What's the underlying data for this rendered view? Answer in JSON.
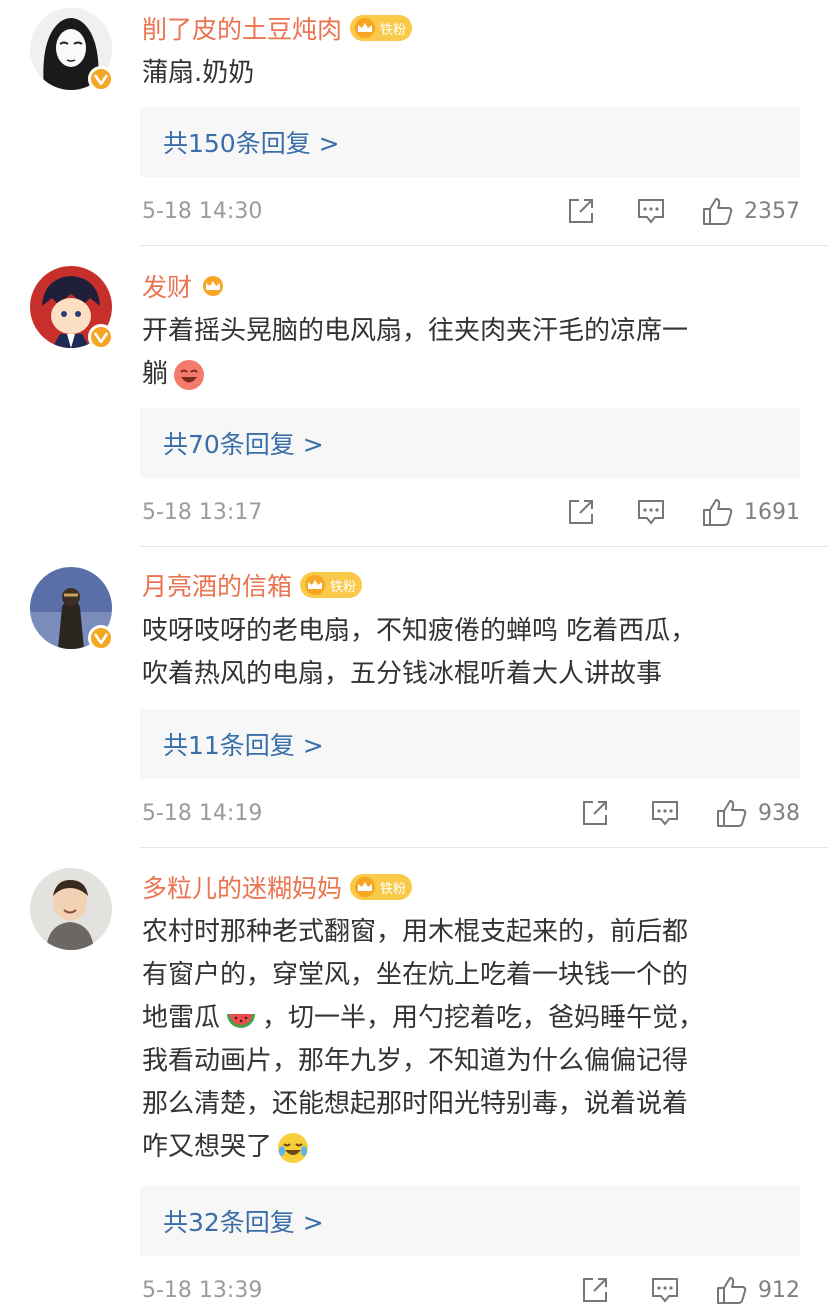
{
  "comments": [
    {
      "username": "削了皮的土豆炖肉",
      "fan_badge_text": "铁粉",
      "text": [
        "蒲扇.奶奶"
      ],
      "replies_label": "共150条回复 >",
      "time": "5-18 14:30",
      "likes": "2357"
    },
    {
      "username": "发财",
      "fan_badge_text": "",
      "text": [
        "开着摇头晃脑的电风扇，往夹肉夹汗毛的凉席一",
        "躺"
      ],
      "replies_label": "共70条回复 >",
      "time": "5-18 13:17",
      "likes": "1691"
    },
    {
      "username": "月亮酒的信箱",
      "fan_badge_text": "铁粉",
      "text": [
        "吱呀吱呀的老电扇，不知疲倦的蝉鸣 吃着西瓜，",
        "吹着热风的电扇，五分钱冰棍听着大人讲故事"
      ],
      "replies_label": "共11条回复 >",
      "time": "5-18 14:19",
      "likes": "938"
    },
    {
      "username": "多粒儿的迷糊妈妈",
      "fan_badge_text": "铁粉",
      "text": [
        "农村时那种老式翻窗，用木棍支起来的，前后都",
        "有窗户的，穿堂风，坐在炕上吃着一块钱一个的",
        "地雷瓜",
        "，切一半，用勺挖着吃，爸妈睡午觉，",
        "我看动画片，那年九岁，不知道为什么偏偏记得",
        "那么清楚，还能想起那时阳光特别毒，说着说着",
        "咋又想哭了"
      ],
      "replies_label": "共32条回复 >",
      "time": "5-18 13:39",
      "likes": "912"
    }
  ],
  "icons": {
    "verified": "verified-v-icon",
    "crown": "crown-icon",
    "share": "share-icon",
    "comment": "comment-icon",
    "like": "thumbs-up-icon"
  },
  "colors": {
    "username": "#eb7350",
    "link": "#3a6ea8",
    "verified": "#f5a623",
    "meta": "#9b9b9b"
  }
}
